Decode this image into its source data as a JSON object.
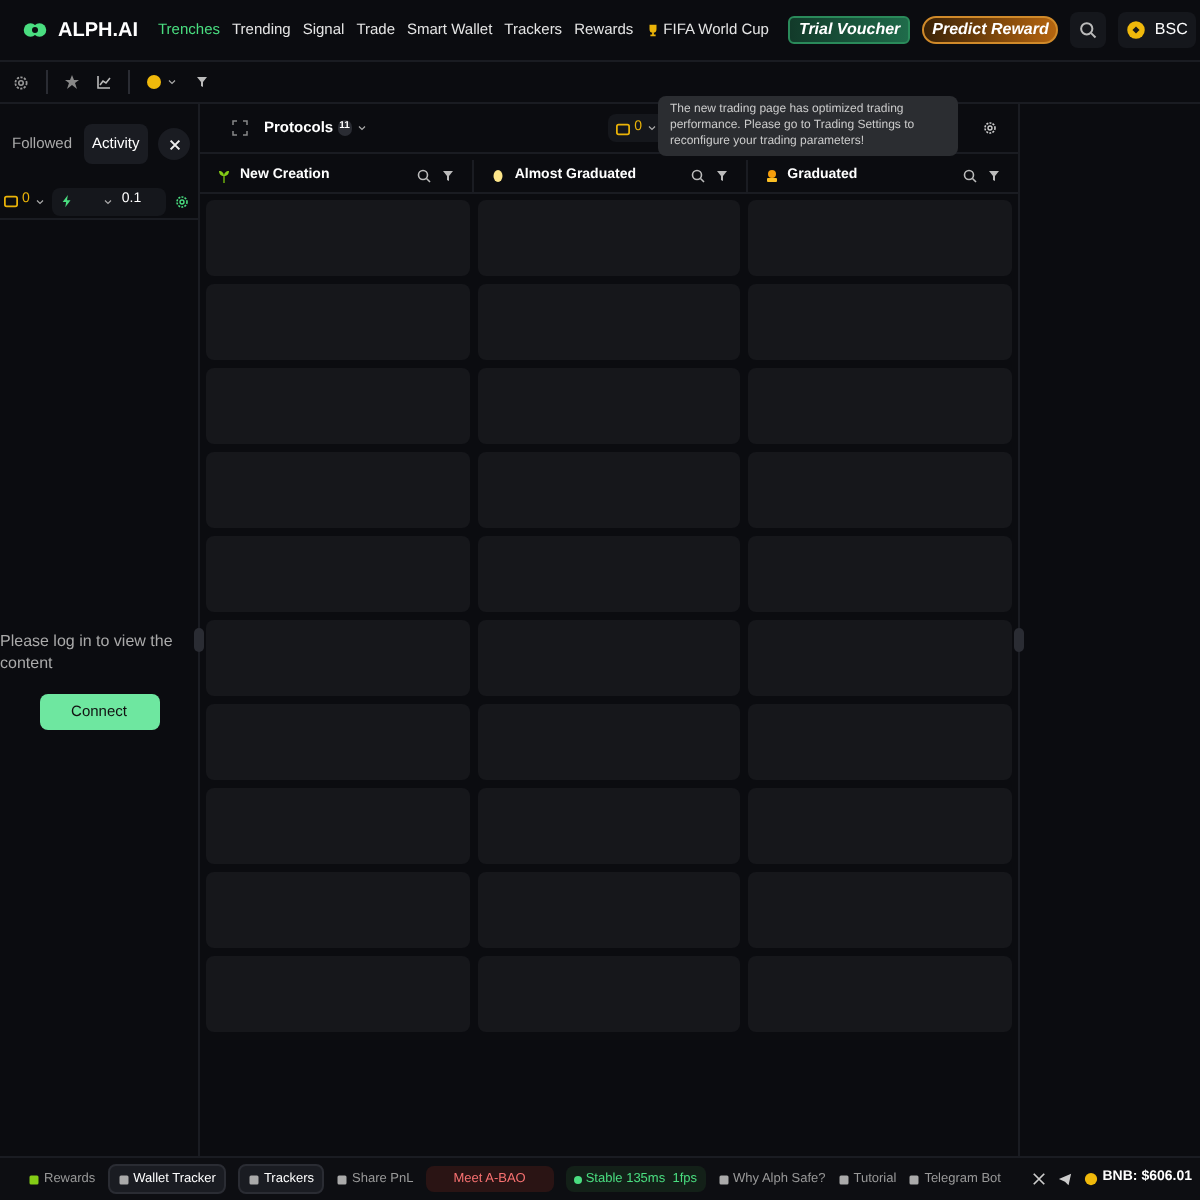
{
  "header": {
    "logo": "ALPH.AI",
    "nav": [
      {
        "label": "Trenches",
        "selected": true
      },
      {
        "label": "Trending",
        "selected": false
      },
      {
        "label": "Signal",
        "selected": false
      },
      {
        "label": "Trade",
        "selected": false
      },
      {
        "label": "Smart Wallet",
        "selected": false
      },
      {
        "label": "Trackers",
        "selected": false
      },
      {
        "label": "Rewards",
        "selected": false
      },
      {
        "label": "FIFA World Cup",
        "selected": false
      }
    ],
    "trial": "Trial Voucher",
    "predict": "Predict Reward",
    "chain": "BSC"
  },
  "sidebar": {
    "tabs": [
      {
        "label": "Followed",
        "selected": false
      },
      {
        "label": "Activity",
        "selected": true
      }
    ],
    "wallet_count": "0",
    "amount": "0.1",
    "message": "Please log in to view the content",
    "connect": "Connect"
  },
  "protocols": {
    "label": "Protocols",
    "count": "11",
    "wallet_count": "0",
    "columns": [
      {
        "title": "New Creation"
      },
      {
        "title": "Almost Graduated"
      },
      {
        "title": "Graduated"
      }
    ]
  },
  "tooltip": "The new trading page has optimized trading performance. Please go to Trading Settings to reconfigure your trading parameters!",
  "footer": {
    "items": [
      {
        "kind": "plain",
        "label": "Rewards"
      },
      {
        "kind": "boxed",
        "label": "Wallet Tracker"
      },
      {
        "kind": "boxed",
        "label": "Trackers"
      },
      {
        "kind": "plain",
        "label": "Share PnL"
      },
      {
        "kind": "alert",
        "label": "Meet A-BAO"
      },
      {
        "kind": "status",
        "label": "Stable 135ms  1fps"
      },
      {
        "kind": "plain",
        "label": "Why Alph Safe?"
      },
      {
        "kind": "plain",
        "label": "Tutorial"
      },
      {
        "kind": "plain",
        "label": "Telegram Bot"
      }
    ],
    "price": "BNB: $606.01"
  }
}
